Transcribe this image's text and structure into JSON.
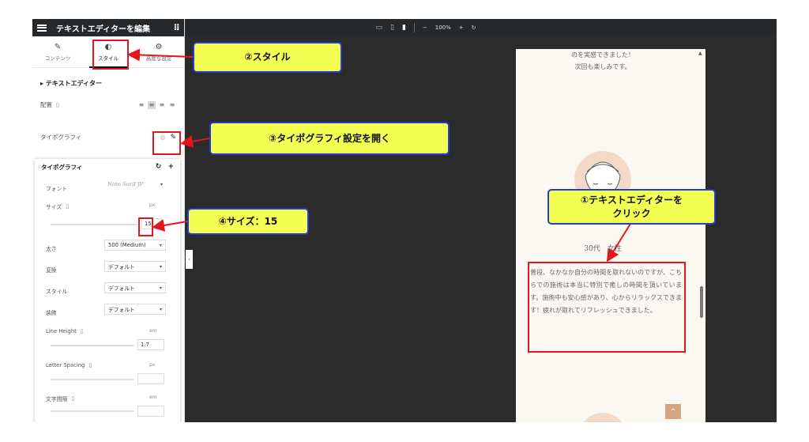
{
  "panel": {
    "title": "テキストエディターを編集",
    "tabs": [
      {
        "label": "コンテンツ",
        "icon": "pencil-icon"
      },
      {
        "label": "スタイル",
        "icon": "contrast-icon"
      },
      {
        "label": "高度な設定",
        "icon": "gear-icon"
      }
    ],
    "section_title": "テキストエディター",
    "alignment_label": "配置",
    "typography_label": "タイポグラフィ"
  },
  "typography": {
    "title": "タイポグラフィ",
    "font_label": "フォント",
    "font_value": "Noto Serif JP",
    "size_label": "サイズ",
    "size_unit": "px",
    "size_value": "15",
    "weight_label": "太さ",
    "weight_value": "500 (Medium)",
    "transform_label": "変換",
    "transform_value": "デフォルト",
    "style_label": "スタイル",
    "style_value": "デフォルト",
    "decoration_label": "装飾",
    "decoration_value": "デフォルト",
    "line_height_label": "Line Height",
    "line_height_unit": "em",
    "line_height_value": "1.7",
    "letter_spacing_label": "Letter Spacing",
    "letter_spacing_unit": "px",
    "word_spacing_label": "文字間隔",
    "word_spacing_unit": "em"
  },
  "toolbar": {
    "zoom": "100%",
    "minus": "−",
    "plus": "+",
    "undo": "↻"
  },
  "preview": {
    "top_text_1": "のを実感できました！",
    "top_text_2": "次回も楽しみです。",
    "age_label": "30代　女性",
    "review_text": "普段、なかなか自分の時間を取れないのですが、こちらでの施術は本当に特別で癒しの時間を頂いています。施術中も安心感があり、心からリラックスできます！疲れが取れてリフレッシュできました。"
  },
  "callouts": {
    "step1": "①テキストエディターを\nクリック",
    "step2": "②スタイル",
    "step3": "③タイポグラフィ設定を開く",
    "step4": "④サイズ：15"
  },
  "colors": {
    "callout_bg": "#f3ff52",
    "callout_border": "#2a3bd1",
    "highlight_red": "#e2161c",
    "accent": "#d4a582"
  }
}
